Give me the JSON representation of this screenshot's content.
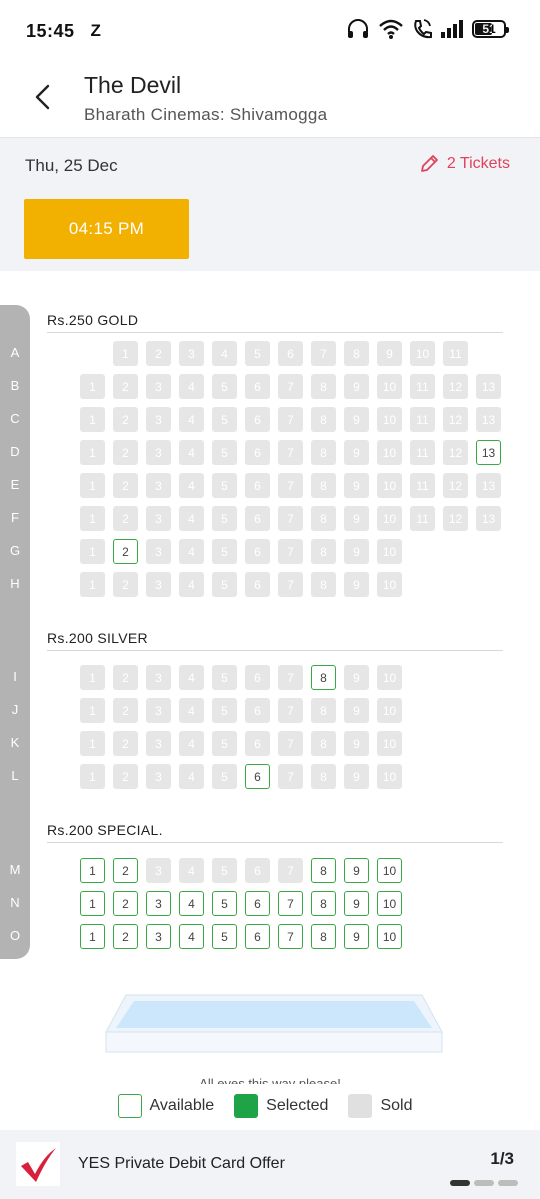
{
  "status": {
    "time": "15:45",
    "carrier_icon": "Z",
    "battery": "51"
  },
  "header": {
    "title": "The Devil",
    "subtitle": "Bharath Cinemas: Shivamogga",
    "back_icon": "back-arrow-icon"
  },
  "show": {
    "date": "Thu, 25 Dec",
    "tickets_label": "2 Tickets",
    "time": "04:15 PM"
  },
  "sections": [
    {
      "label": "Rs.250  GOLD",
      "rows": [
        {
          "letter": "A",
          "seats": [
            1,
            2,
            3,
            4,
            5,
            6,
            7,
            8,
            9,
            10,
            11
          ],
          "offset": 1,
          "available": []
        },
        {
          "letter": "B",
          "seats": [
            1,
            2,
            3,
            4,
            5,
            6,
            7,
            8,
            9,
            10,
            11,
            12,
            13
          ],
          "offset": 0,
          "available": []
        },
        {
          "letter": "C",
          "seats": [
            1,
            2,
            3,
            4,
            5,
            6,
            7,
            8,
            9,
            10,
            11,
            12,
            13
          ],
          "offset": 0,
          "available": []
        },
        {
          "letter": "D",
          "seats": [
            1,
            2,
            3,
            4,
            5,
            6,
            7,
            8,
            9,
            10,
            11,
            12,
            13
          ],
          "offset": 0,
          "available": [
            13
          ]
        },
        {
          "letter": "E",
          "seats": [
            1,
            2,
            3,
            4,
            5,
            6,
            7,
            8,
            9,
            10,
            11,
            12,
            13
          ],
          "offset": 0,
          "available": []
        },
        {
          "letter": "F",
          "seats": [
            1,
            2,
            3,
            4,
            5,
            6,
            7,
            8,
            9,
            10,
            11,
            12,
            13
          ],
          "offset": 0,
          "available": []
        },
        {
          "letter": "G",
          "seats": [
            1,
            2,
            3,
            4,
            5,
            6,
            7,
            8,
            9,
            10
          ],
          "offset": 0,
          "available": [
            2
          ]
        },
        {
          "letter": "H",
          "seats": [
            1,
            2,
            3,
            4,
            5,
            6,
            7,
            8,
            9,
            10
          ],
          "offset": 0,
          "available": []
        }
      ]
    },
    {
      "label": "Rs.200  SILVER",
      "rows": [
        {
          "letter": "I",
          "seats": [
            1,
            2,
            3,
            4,
            5,
            6,
            7,
            8,
            9,
            10
          ],
          "offset": 0,
          "available": [
            8
          ]
        },
        {
          "letter": "J",
          "seats": [
            1,
            2,
            3,
            4,
            5,
            6,
            7,
            8,
            9,
            10
          ],
          "offset": 0,
          "available": []
        },
        {
          "letter": "K",
          "seats": [
            1,
            2,
            3,
            4,
            5,
            6,
            7,
            8,
            9,
            10
          ],
          "offset": 0,
          "available": []
        },
        {
          "letter": "L",
          "seats": [
            1,
            2,
            3,
            4,
            5,
            6,
            7,
            8,
            9,
            10
          ],
          "offset": 0,
          "available": [
            6
          ]
        }
      ]
    },
    {
      "label": "Rs.200  SPECIAL.",
      "rows": [
        {
          "letter": "M",
          "seats": [
            1,
            2,
            3,
            4,
            5,
            6,
            7,
            8,
            9,
            10
          ],
          "offset": 0,
          "available": [
            1,
            2,
            8,
            9,
            10
          ]
        },
        {
          "letter": "N",
          "seats": [
            1,
            2,
            3,
            4,
            5,
            6,
            7,
            8,
            9,
            10
          ],
          "offset": 0,
          "available": [
            1,
            2,
            3,
            4,
            5,
            6,
            7,
            8,
            9,
            10
          ]
        },
        {
          "letter": "O",
          "seats": [
            1,
            2,
            3,
            4,
            5,
            6,
            7,
            8,
            9,
            10
          ],
          "offset": 0,
          "available": [
            1,
            2,
            3,
            4,
            5,
            6,
            7,
            8,
            9,
            10
          ]
        }
      ]
    }
  ],
  "screen_caption": "All eyes this way please!",
  "legend": {
    "available": "Available",
    "selected": "Selected",
    "sold": "Sold"
  },
  "offer": {
    "text": "YES Private Debit Card Offer",
    "page": "1/3"
  },
  "colors": {
    "accent": "#f2b000",
    "available": "#3aa845",
    "selected": "#1ea446",
    "sold": "#e6e6e6",
    "tickets": "#e0435c"
  }
}
